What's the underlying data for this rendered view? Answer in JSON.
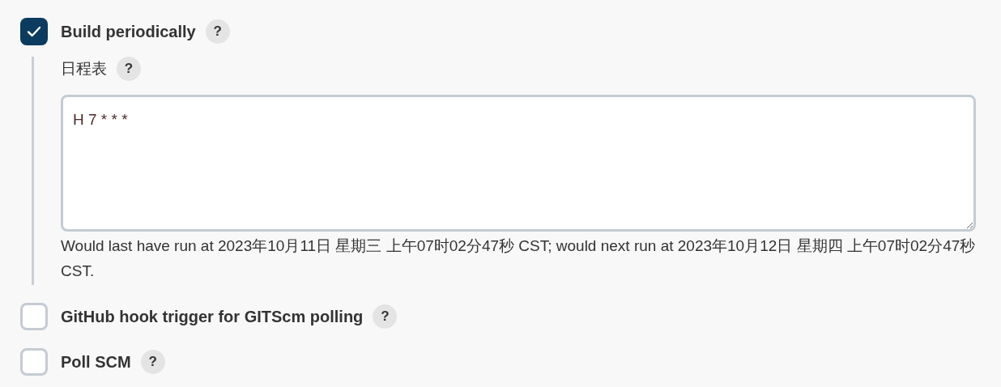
{
  "triggers": [
    {
      "label": "Build periodically",
      "checked": true,
      "help": "?",
      "schedule": {
        "label": "日程表",
        "help": "?",
        "value": "H 7 * * *",
        "note": "Would last have run at 2023年10月11日 星期三 上午07时02分47秒 CST; would next run at 2023年10月12日 星期四 上午07时02分47秒 CST."
      }
    },
    {
      "label": "GitHub hook trigger for GITScm polling",
      "checked": false,
      "help": "?"
    },
    {
      "label": "Poll SCM",
      "checked": false,
      "help": "?"
    }
  ]
}
